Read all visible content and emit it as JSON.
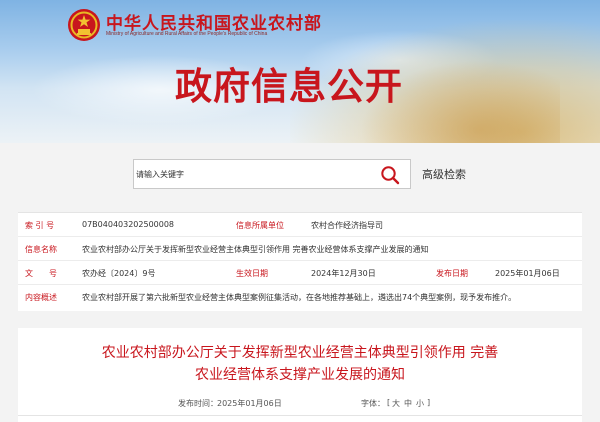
{
  "header": {
    "site_title": "中华人民共和国农业农村部",
    "site_subtitle": "Ministry of Agriculture and Rural Affairs of the People's Republic of China",
    "page_heading": "政府信息公开"
  },
  "search": {
    "placeholder": "请输入关键字",
    "advanced_label": "高级检索"
  },
  "info": {
    "index_label": "索 引 号",
    "index_value": "07B040403202500008",
    "org_label": "信息所属单位",
    "org_value": "农村合作经济指导司",
    "name_label": "信息名称",
    "name_value": "农业农村部办公厅关于发挥新型农业经营主体典型引领作用 完善农业经营体系支撑产业发展的通知",
    "doc_label": "文　　号",
    "doc_value": "农办经〔2024〕9号",
    "effective_label": "生效日期",
    "effective_value": "2024年12月30日",
    "publish_label": "发布日期",
    "publish_value": "2025年01月06日",
    "summary_label": "内容概述",
    "summary_value": "农业农村部开展了第六批新型农业经营主体典型案例征集活动，在各地推荐基础上，遴选出74个典型案例，现予发布推介。"
  },
  "article": {
    "title_line1": "农业农村部办公厅关于发挥新型农业经营主体典型引领作用 完善",
    "title_line2": "农业经营体系支撑产业发展的通知",
    "date_label": "发布时间：",
    "date_value": "2025年01月06日",
    "font_label": "字体：",
    "font_open": "[",
    "font_large": "大",
    "font_medium": "中",
    "font_small": "小",
    "font_close": "]"
  },
  "colors": {
    "accent_red": "#c8161d",
    "text": "#333333"
  },
  "icons": {
    "emblem": "national-emblem-icon",
    "search": "search-icon"
  }
}
